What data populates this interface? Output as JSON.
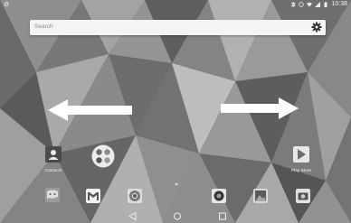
{
  "status_bar": {
    "left_icon": "android-notification-icon",
    "time": "10:38",
    "right_icons": [
      "bluetooth-icon",
      "alarm-icon",
      "wifi-icon",
      "signal-icon",
      "battery-icon"
    ]
  },
  "search": {
    "placeholder": "Search",
    "settings_icon": "gear-icon"
  },
  "gestures": {
    "left_arrow": "arrow-left-icon",
    "right_arrow": "arrow-right-icon"
  },
  "home_apps": [
    {
      "label": "Contacts",
      "icon": "contacts-icon"
    },
    {
      "label": "",
      "icon": "apps-drawer-icon"
    },
    {
      "label": "Play Store",
      "icon": "play-store-icon"
    }
  ],
  "dock": [
    {
      "label": "",
      "icon": "messaging-icon"
    },
    {
      "label": "",
      "icon": "gmail-icon"
    },
    {
      "label": "",
      "icon": "chrome-icon"
    },
    {
      "label": "",
      "icon": "camera-icon"
    },
    {
      "label": "",
      "icon": "gallery-icon"
    },
    {
      "label": "",
      "icon": "camera2-icon"
    }
  ],
  "nav": {
    "back": "back-icon",
    "home": "home-icon",
    "recents": "recents-icon"
  },
  "colors": {
    "search_bg": "#f4f4f4",
    "wallpaper_mid": "#7a7a7a"
  }
}
